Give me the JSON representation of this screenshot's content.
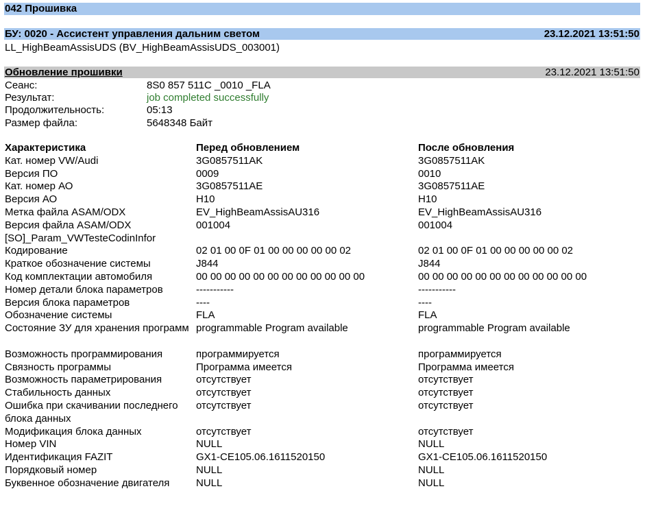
{
  "section_title": "042 Прошивка",
  "unit": {
    "title": "БУ: 0020 - Ассистент управления дальним светом",
    "timestamp": "23.12.2021 13:51:50",
    "subtitle": "LL_HighBeamAssisUDS (BV_HighBeamAssisUDS_003001)"
  },
  "update": {
    "title": "Обновление прошивки",
    "timestamp": "23.12.2021 13:51:50",
    "fields": [
      {
        "label": "Сеанс:",
        "value": "8S0 857 511C _0010 _FLA"
      },
      {
        "label": "Результат:",
        "value": "job completed successfully"
      },
      {
        "label": "Продолжительность:",
        "value": "05:13"
      },
      {
        "label": "Размер файла:",
        "value": "5648348 Байт"
      }
    ]
  },
  "table": {
    "headers": [
      "Характеристика",
      "Перед обновлением",
      "После обновления"
    ],
    "rows": [
      [
        "Кат. номер VW/Audi",
        "3G0857511AK",
        "3G0857511AK"
      ],
      [
        "Версия ПО",
        "0009",
        "0010"
      ],
      [
        "Кат. номер АО",
        "3G0857511AE",
        "3G0857511AE"
      ],
      [
        "Версия АО",
        "H10",
        "H10"
      ],
      [
        "Метка файла ASAM/ODX",
        "EV_HighBeamAssisAU316",
        "EV_HighBeamAssisAU316"
      ],
      [
        "Версия файла ASAM/ODX",
        "001004",
        "001004"
      ],
      [
        "[SO]_Param_VWTesteCodinInfor",
        "",
        ""
      ],
      [
        "Кодирование",
        "02 01 00 0F 01 00 00 00 00 00 02",
        "02 01 00 0F 01 00 00 00 00 00 02"
      ],
      [
        "Краткое обозначение системы",
        "J844",
        "J844"
      ],
      [
        "Код комплектации автомобиля",
        "00 00 00 00 00 00 00 00 00 00 00 00",
        "00 00 00 00 00 00 00 00 00 00 00 00"
      ],
      [
        "Номер детали блока параметров",
        "-----------",
        "-----------"
      ],
      [
        "Версия блока параметров",
        "----",
        "----"
      ],
      [
        "Обозначение системы",
        "FLA",
        "FLA"
      ],
      [
        "Состояние ЗУ для хранения программ",
        "programmable Program available",
        "programmable Program available"
      ],
      [
        "Возможность программирования",
        "программируется",
        "программируется"
      ],
      [
        "Связность программы",
        "Программа имеется",
        "Программа имеется"
      ],
      [
        "Возможность параметрирования",
        "отсутствует",
        "отсутствует"
      ],
      [
        "Стабильность данных",
        "отсутствует",
        "отсутствует"
      ],
      [
        "Ошибка при скачивании последнего блока данных",
        "отсутствует",
        "отсутствует"
      ],
      [
        "Модификация блока данных",
        "отсутствует",
        "отсутствует"
      ],
      [
        "Номер VIN",
        "NULL",
        "NULL"
      ],
      [
        "Идентификация FAZIT",
        "GX1-CE105.06.1611520150",
        "GX1-CE105.06.1611520150"
      ],
      [
        "Порядковый номер",
        "NULL",
        "NULL"
      ],
      [
        "Буквенное обозначение двигателя",
        "NULL",
        "NULL"
      ]
    ]
  }
}
